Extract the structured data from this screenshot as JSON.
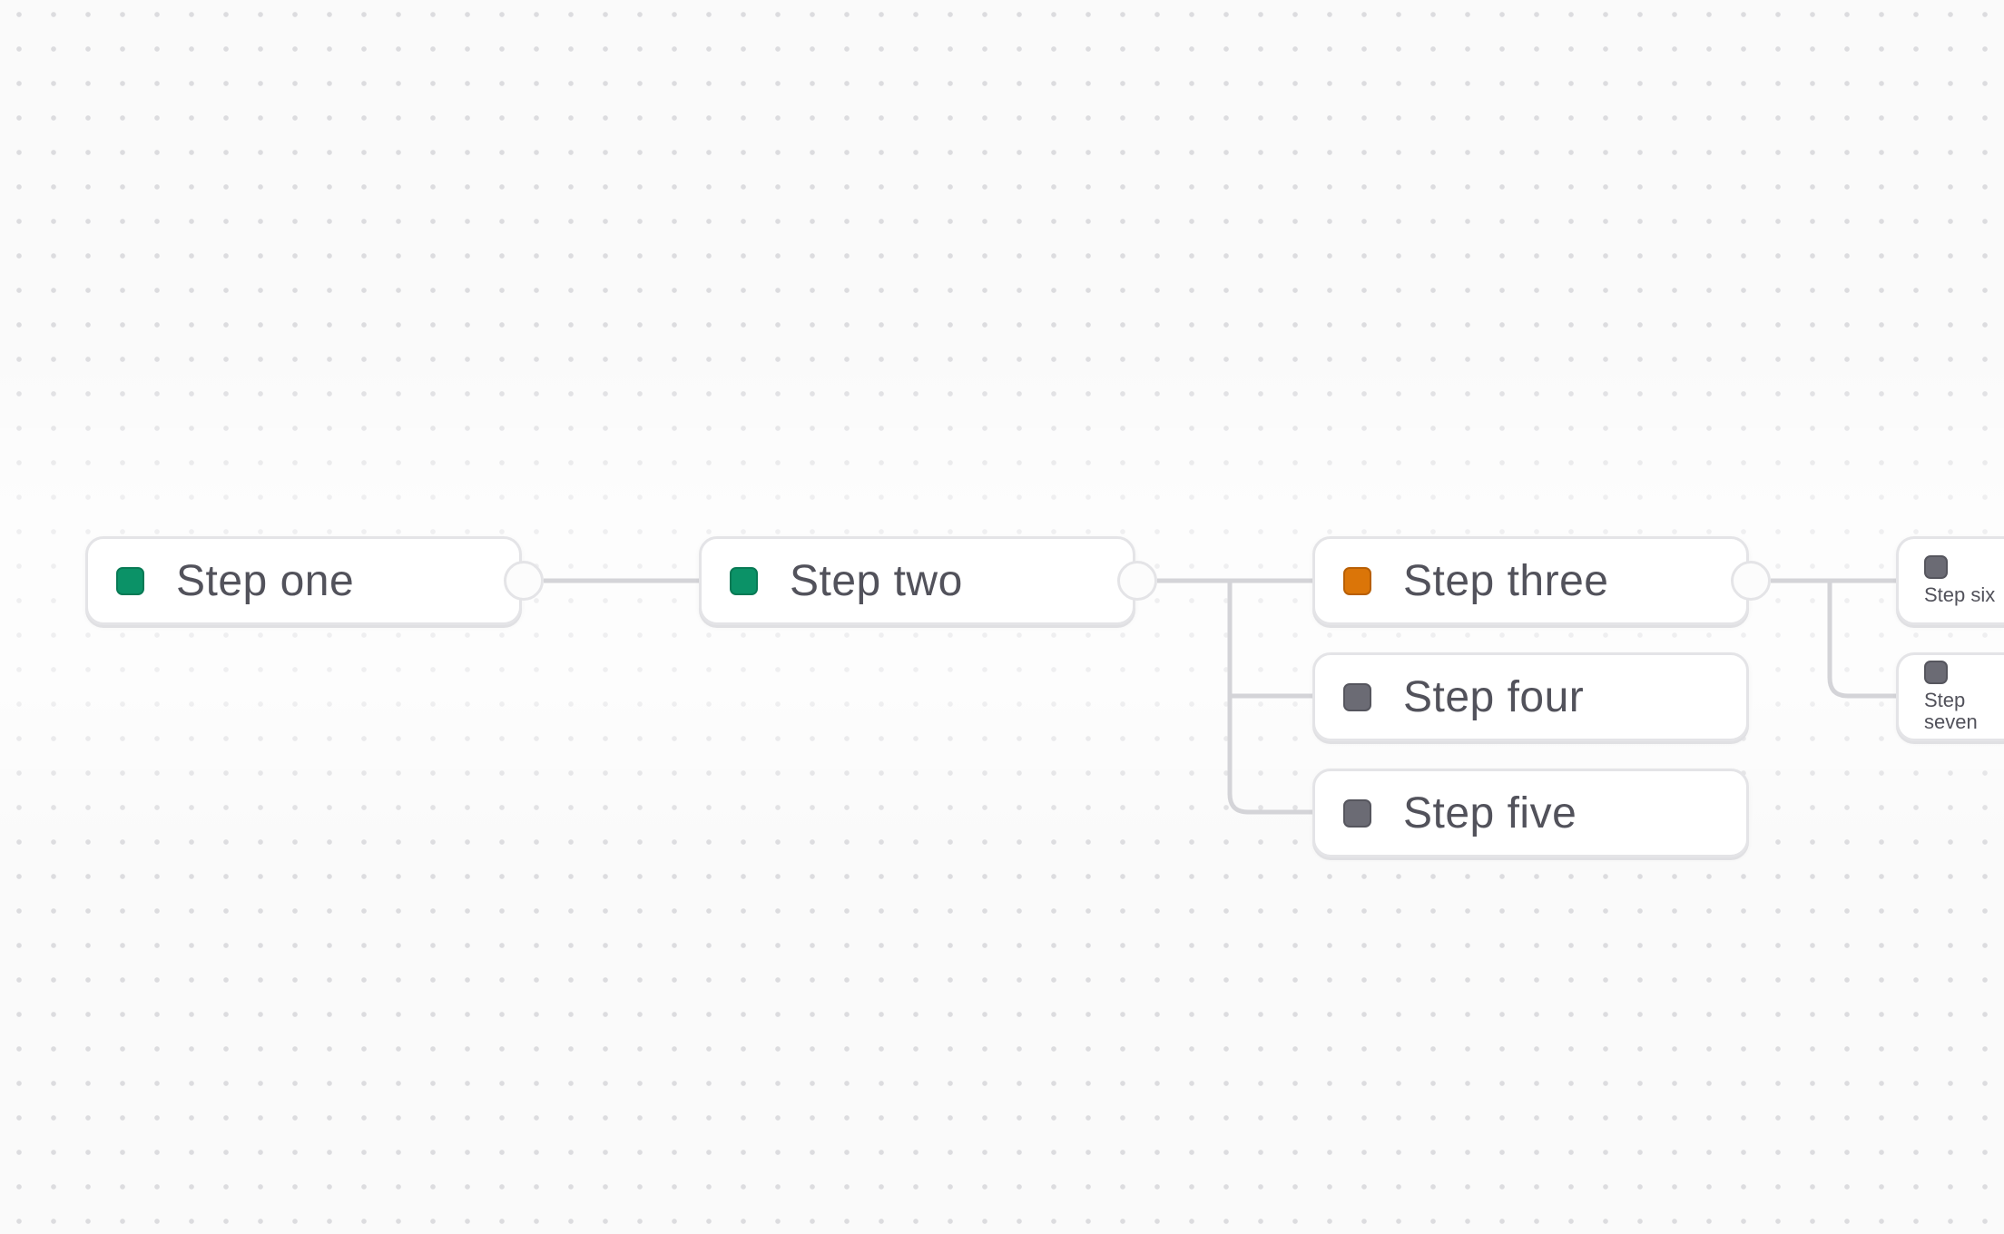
{
  "colors": {
    "done": "#0b9267",
    "active": "#db7508",
    "pending": "#6b6b74",
    "edge": "#d4d4d8"
  },
  "nodes": [
    {
      "label": "Step one",
      "status": "done"
    },
    {
      "label": "Step two",
      "status": "done"
    },
    {
      "label": "Step three",
      "status": "active"
    },
    {
      "label": "Step four",
      "status": "pending"
    },
    {
      "label": "Step five",
      "status": "pending"
    },
    {
      "label": "Step six",
      "status": "pending"
    },
    {
      "label": "Step seven",
      "status": "pending"
    }
  ]
}
